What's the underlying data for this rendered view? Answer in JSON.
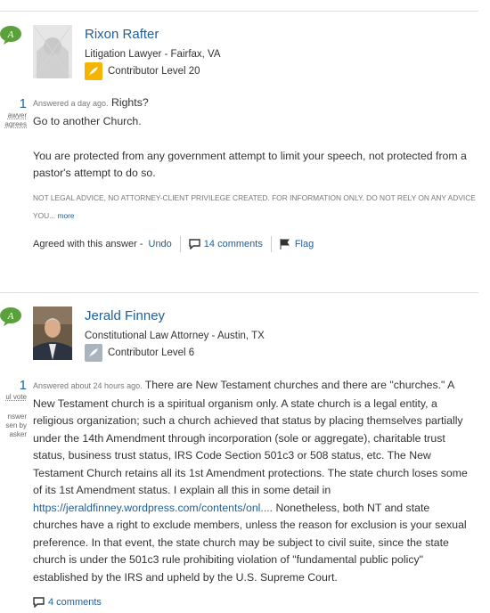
{
  "colors": {
    "link": "#1f5f9a",
    "gold_badge": "#f5b400",
    "gray_badge": "#a9b4bd",
    "logo_green": "#5aa13c"
  },
  "answers": [
    {
      "name": "Rixon Rafter",
      "title": "Litigation Lawyer - Fairfax, VA",
      "level": "Contributor Level 20",
      "votes": "1",
      "vote_label_1": "awyer",
      "vote_label_2": "agrees",
      "meta": "Answered a day ago.",
      "heading": "Rights?",
      "p1": "Go to another Church.",
      "p2": "You are protected from any government attempt to limit your speech, not protected from a pastor's attempt to do so.",
      "disclaimer": "NOT LEGAL ADVICE, NO ATTORNEY-CLIENT PRIVILEGE CREATED. FOR INFORMATION ONLY. DO NOT RELY ON ANY ADVICE YOU...",
      "more": "more",
      "agreed": "Agreed with this answer -",
      "undo": "Undo",
      "comments": "14 comments",
      "flag": "Flag"
    },
    {
      "name": "Jerald Finney",
      "title": "Constitutional Law Attorney - Austin, TX",
      "level": "Contributor Level 6",
      "votes": "1",
      "vote_label_1": "ul vote",
      "vote_label_2": "nswer",
      "vote_label_3": "sen by",
      "vote_label_4": "asker",
      "meta": "Answered about 24 hours ago.",
      "body_a": "There are New Testament churches and there are \"churches.\" A New Testament church is a spiritual organism only. A state church is a legal entity, a religious organization; such a church achieved that status by placing themselves partially under the 14th Amendment through incorporation (sole or aggregate), charitable trust status, business trust status, IRS Code Section 501c3 or 508 status, etc. The New Testament Church retains all its 1st Amendment protections. The state church loses some of its 1st Amendment status. I explain all this in some detail in",
      "link": "https://jeraldfinney.wordpress.com/contents/onl....",
      "body_b": "Nonetheless, both NT and state churches have a right to exclude members, unless the reason for exclusion is your sexual preference. In that event, the state church may be subject to civil suite, since the state church is under the 501c3 rule prohibiting violation of \"fundamental public policy\" established by the IRS and upheld by the U.S. Supreme Court.",
      "comments": "4 comments"
    }
  ]
}
